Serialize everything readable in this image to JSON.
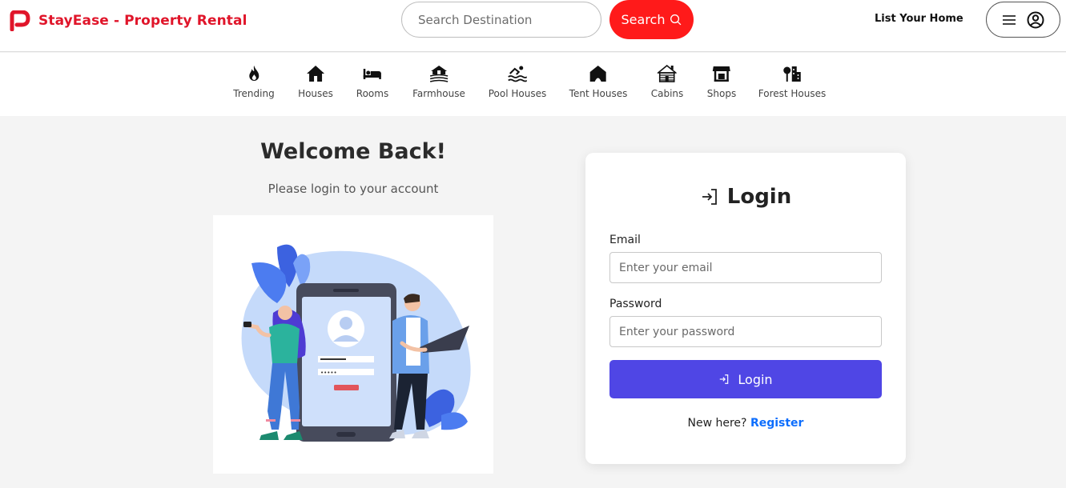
{
  "header": {
    "brand_name": "StayEase - Property Rental",
    "brand_color": "#e0152a",
    "search_placeholder": "Search Destination",
    "search_button_label": "Search",
    "search_button_color": "#ff1a1a",
    "list_home_label": "List Your Home",
    "user_menu_icons": [
      "menu-icon",
      "user-circle-icon"
    ]
  },
  "categories": [
    {
      "label": "Trending",
      "icon": "flame-icon"
    },
    {
      "label": "Houses",
      "icon": "house-icon"
    },
    {
      "label": "Rooms",
      "icon": "bed-icon"
    },
    {
      "label": "Farmhouse",
      "icon": "farmhouse-icon"
    },
    {
      "label": "Pool Houses",
      "icon": "pool-icon"
    },
    {
      "label": "Tent Houses",
      "icon": "tent-icon"
    },
    {
      "label": "Cabins",
      "icon": "cabin-icon"
    },
    {
      "label": "Shops",
      "icon": "shop-icon"
    },
    {
      "label": "Forest Houses",
      "icon": "forest-house-icon"
    }
  ],
  "welcome": {
    "title": "Welcome Back!",
    "subtitle": "Please login to your account"
  },
  "login": {
    "heading": "Login",
    "email_label": "Email",
    "email_placeholder": "Enter your email",
    "password_label": "Password",
    "password_placeholder": "Enter your password",
    "submit_label": "Login",
    "submit_color": "#4f46e5",
    "register_prompt": "New here?",
    "register_link": "Register"
  }
}
